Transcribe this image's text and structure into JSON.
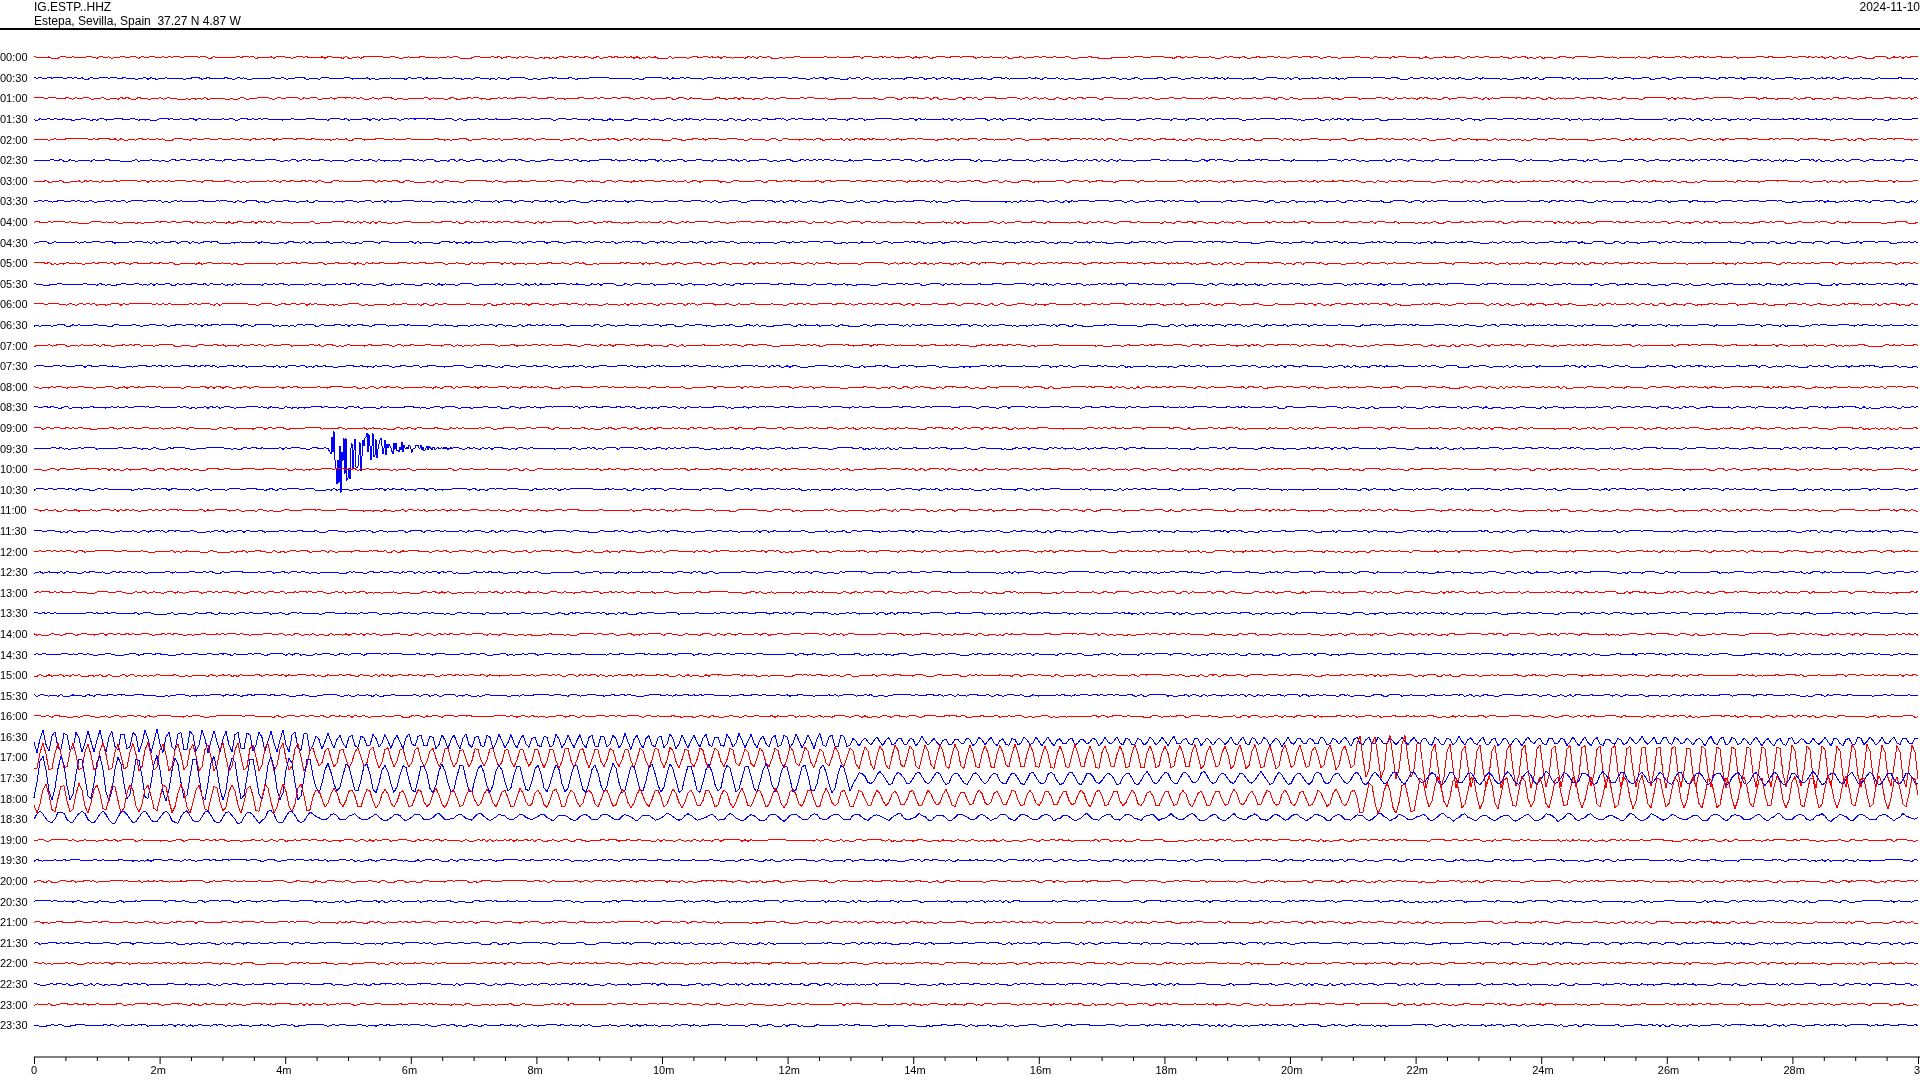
{
  "header": {
    "station": "IG.ESTP..HHZ",
    "location": "Estepa, Sevilla, Spain  37.27 N 4.87 W",
    "date": "2024-11-10"
  },
  "rows": [
    {
      "time": "00:00",
      "color": "#ff0000"
    },
    {
      "time": "00:30",
      "color": "#0000ff"
    },
    {
      "time": "01:00",
      "color": "#ff0000"
    },
    {
      "time": "01:30",
      "color": "#0000ff"
    },
    {
      "time": "02:00",
      "color": "#ff0000"
    },
    {
      "time": "02:30",
      "color": "#0000ff"
    },
    {
      "time": "03:00",
      "color": "#ff0000"
    },
    {
      "time": "03:30",
      "color": "#0000ff"
    },
    {
      "time": "04:00",
      "color": "#ff0000"
    },
    {
      "time": "04:30",
      "color": "#0000ff"
    },
    {
      "time": "05:00",
      "color": "#ff0000"
    },
    {
      "time": "05:30",
      "color": "#0000ff"
    },
    {
      "time": "06:00",
      "color": "#ff0000"
    },
    {
      "time": "06:30",
      "color": "#0000ff"
    },
    {
      "time": "07:00",
      "color": "#ff0000"
    },
    {
      "time": "07:30",
      "color": "#0000ff"
    },
    {
      "time": "08:00",
      "color": "#ff0000"
    },
    {
      "time": "08:30",
      "color": "#0000ff"
    },
    {
      "time": "09:00",
      "color": "#ff0000"
    },
    {
      "time": "09:30",
      "color": "#0000ff"
    },
    {
      "time": "10:00",
      "color": "#ff0000"
    },
    {
      "time": "10:30",
      "color": "#0000ff"
    },
    {
      "time": "11:00",
      "color": "#ff0000"
    },
    {
      "time": "11:30",
      "color": "#0000ff"
    },
    {
      "time": "12:00",
      "color": "#ff0000"
    },
    {
      "time": "12:30",
      "color": "#0000ff"
    },
    {
      "time": "13:00",
      "color": "#ff0000"
    },
    {
      "time": "13:30",
      "color": "#0000ff"
    },
    {
      "time": "14:00",
      "color": "#ff0000"
    },
    {
      "time": "14:30",
      "color": "#0000ff"
    },
    {
      "time": "15:00",
      "color": "#ff0000"
    },
    {
      "time": "15:30",
      "color": "#0000ff"
    },
    {
      "time": "16:00",
      "color": "#ff0000"
    },
    {
      "time": "16:30",
      "color": "#0000ff"
    },
    {
      "time": "17:00",
      "color": "#ff0000"
    },
    {
      "time": "17:30",
      "color": "#0000ff"
    },
    {
      "time": "18:00",
      "color": "#ff0000"
    },
    {
      "time": "18:30",
      "color": "#0000ff"
    },
    {
      "time": "19:00",
      "color": "#ff0000"
    },
    {
      "time": "19:30",
      "color": "#0000ff"
    },
    {
      "time": "20:00",
      "color": "#ff0000"
    },
    {
      "time": "20:30",
      "color": "#0000ff"
    },
    {
      "time": "21:00",
      "color": "#ff0000"
    },
    {
      "time": "21:30",
      "color": "#0000ff"
    },
    {
      "time": "22:00",
      "color": "#ff0000"
    },
    {
      "time": "22:30",
      "color": "#0000ff"
    },
    {
      "time": "23:00",
      "color": "#ff0000"
    },
    {
      "time": "23:30",
      "color": "#0000ff"
    }
  ],
  "x_axis": {
    "labels": [
      "0",
      "2m",
      "4m",
      "6m",
      "8m",
      "10m",
      "12m",
      "14m",
      "16m",
      "18m",
      "20m",
      "22m",
      "24m",
      "26m",
      "28m",
      "3"
    ]
  }
}
